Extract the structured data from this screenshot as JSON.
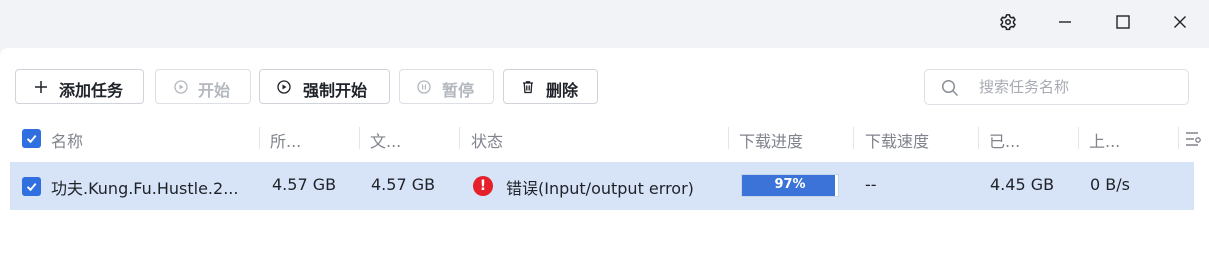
{
  "window": {
    "settings_icon": "gear-icon",
    "minimize_icon": "minimize-icon",
    "maximize_icon": "maximize-icon",
    "close_icon": "close-icon"
  },
  "toolbar": {
    "add_task": "添加任务",
    "start": "开始",
    "force_start": "强制开始",
    "pause": "暂停",
    "delete": "删除"
  },
  "search": {
    "placeholder": "搜索任务名称"
  },
  "table": {
    "columns": [
      "名称",
      "所...",
      "文...",
      "状态",
      "下载进度",
      "下载速度",
      "已...",
      "上..."
    ],
    "rows": [
      {
        "name": "功夫.Kung.Fu.Hustle.2...",
        "size": "4.57 GB",
        "file_size": "4.57 GB",
        "status": "错误(Input/output error)",
        "progress_label": "97%",
        "progress": 0.97,
        "speed": "--",
        "downloaded": "4.45 GB",
        "upload_speed": "0 B/s"
      }
    ]
  },
  "colors": {
    "accent": "#2f6fe0",
    "selected_row": "#d7e3f7",
    "error": "#e5202b",
    "progress_fill": "#3b73d8"
  }
}
